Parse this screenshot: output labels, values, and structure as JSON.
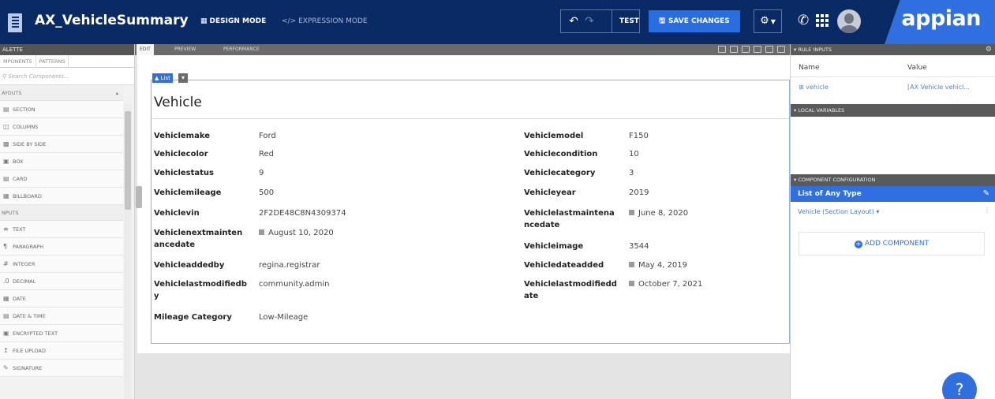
{
  "app": {
    "title": "AX_VehicleSummary",
    "brand": "appian"
  },
  "modes": {
    "design": "DESIGN MODE",
    "expression": "EXPRESSION MODE"
  },
  "toolbar": {
    "test": "TEST",
    "save": "SAVE CHANGES"
  },
  "icons": {
    "undo": "undo-icon",
    "redo": "redo-icon",
    "gear": "gear-icon",
    "help": "help-icon"
  },
  "palette": {
    "header": "ALETTE",
    "tabs": [
      "MPONENTS",
      "PATTERNS"
    ],
    "search_placeholder": "Search Components...",
    "sections": [
      {
        "label": "AYOUTS",
        "items": [
          "SECTION",
          "COLUMNS",
          "SIDE BY SIDE",
          "BOX",
          "CARD",
          "BILLBOARD"
        ]
      },
      {
        "label": "NPUTS",
        "items": [
          "TEXT",
          "PARAGRAPH",
          "INTEGER",
          "DECIMAL",
          "DATE",
          "DATE & TIME",
          "ENCRYPTED TEXT",
          "FILE UPLOAD",
          "SIGNATURE"
        ]
      }
    ]
  },
  "canvas_tabs": {
    "edit": "EDIT",
    "preview": "PREVIEW",
    "performance": "PERFORMANCE"
  },
  "card": {
    "badge": "List",
    "title": "Vehicle",
    "left_fields": [
      {
        "label": "Vehiclemake",
        "value": "Ford",
        "date": false
      },
      {
        "label": "Vehiclecolor",
        "value": "Red",
        "date": false
      },
      {
        "label": "Vehiclestatus",
        "value": "9",
        "date": false
      },
      {
        "label": "Vehiclemileage",
        "value": "500",
        "date": false
      },
      {
        "label": "Vehiclevin",
        "value": "2F2DE48C8N4309374",
        "date": false
      },
      {
        "label": "Vehiclenextmainten",
        "label2": "ancedate",
        "value": "August 10, 2020",
        "date": true
      },
      {
        "label": "Vehicleaddedby",
        "value": "regina.registrar",
        "date": false
      },
      {
        "label": "Vehiclelastmodifiedb",
        "label2": "y",
        "value": "community.admin",
        "date": false
      },
      {
        "label": "Mileage Category",
        "value": "Low-Mileage",
        "date": false
      }
    ],
    "right_fields": [
      {
        "label": "Vehiclemodel",
        "value": "F150",
        "date": false
      },
      {
        "label": "Vehiclecondition",
        "value": "10",
        "date": false
      },
      {
        "label": "Vehiclecategory",
        "value": "3",
        "date": false
      },
      {
        "label": "Vehicleyear",
        "value": "2019",
        "date": false
      },
      {
        "label": "Vehiclelastmaintena",
        "label2": "ncedate",
        "value": "June 8, 2020",
        "date": true
      },
      {
        "label": "Vehicleimage",
        "value": "3544",
        "date": false
      },
      {
        "label": "Vehicledateadded",
        "value": "May 4, 2019",
        "date": true
      },
      {
        "label": "Vehiclelastmodifiedd",
        "label2": "ate",
        "value": "October 7, 2021",
        "date": true
      }
    ]
  },
  "right_panel": {
    "rule_inputs": "RULE INPUTS",
    "col_name": "Name",
    "col_value": "Value",
    "rule_row": {
      "name": "vehicle",
      "value": "[AX Vehicle vehicl..."
    },
    "local_variables": "LOCAL VARIABLES",
    "component_config": "COMPONENT CONFIGURATION",
    "list_type": "List of Any Type",
    "layout_item": "Vehicle (Section Layout)",
    "add_component": "ADD COMPONENT"
  }
}
